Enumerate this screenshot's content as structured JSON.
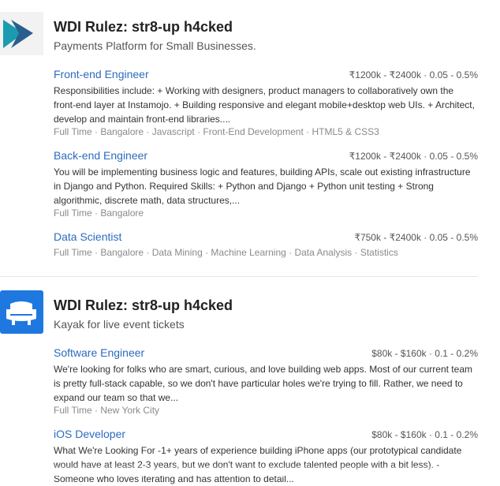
{
  "companies": [
    {
      "name": "WDI Rulez: str8-up h4cked",
      "tagline": "Payments Platform for Small Businesses.",
      "logo_icon": "instamojo-logo-icon",
      "jobs": [
        {
          "title": "Front-end Engineer",
          "compensation": "₹1200k - ₹2400k · 0.05 - 0.5%",
          "description": "Responsibilities include: + Working with designers, product managers to collaboratively own the front-end layer at Instamojo. + Building responsive and elegant mobile+desktop web UIs. + Architect, develop and maintain front-end libraries....",
          "tags": "Full Time · Bangalore · Javascript · Front-End Development · HTML5 & CSS3"
        },
        {
          "title": "Back-end Engineer",
          "compensation": "₹1200k - ₹2400k · 0.05 - 0.5%",
          "description": "You will be implementing business logic and features, building APIs, scale out existing infrastructure in Django and Python. Required Skills: + Python and Django + Python unit testing + Strong algorithmic, discrete math, data structures,...",
          "tags": "Full Time · Bangalore"
        },
        {
          "title": "Data Scientist",
          "compensation": "₹750k - ₹2400k · 0.05 - 0.5%",
          "tags": "Full Time · Bangalore · Data Mining · Machine Learning · Data Analysis · Statistics"
        }
      ]
    },
    {
      "name": "WDI Rulez: str8-up h4cked",
      "tagline": "Kayak for live event tickets",
      "logo_icon": "seat-logo-icon",
      "jobs": [
        {
          "title": "Software Engineer",
          "compensation": "$80k - $160k · 0.1 - 0.2%",
          "description": "We're looking for folks who are smart, curious, and love building web apps. Most of our current team is pretty full-stack capable, so we don't have particular holes we're trying to fill. Rather, we need to expand our team so that we...",
          "tags": "Full Time · New York City"
        },
        {
          "title": "iOS Developer",
          "compensation": "$80k - $160k · 0.1 - 0.2%",
          "description": "What We're Looking For -1+ years of experience building iPhone apps (our prototypical candidate would have at least 2-3 years, but we don't want to exclude talented people with a bit less). - Someone who loves iterating and has attention to detail..."
        }
      ]
    }
  ],
  "colors": {
    "link": "#2c6bbf",
    "muted": "#8a8a8a",
    "logo_teal": "#1b9bb0",
    "logo_blue": "#1e78e0"
  }
}
